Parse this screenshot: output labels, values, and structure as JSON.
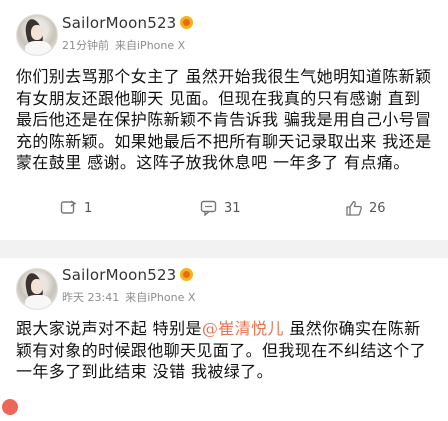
{
  "posts": [
    {
      "username": "SailorMoon523",
      "time": "21分钟前",
      "source": "来自iPhone X",
      "content": "你们别去骂那个女主了 虽然开始我很生气她明知道陈新颖有女朋友还跟他聊天 见面。但现在我真的只有感谢 直到最后他还是在保护陈新颖不肯告诉我 骗我是用自己小号冒充的陈新颖。如果她最后不把所有聊天记录取出来 我还是蒙在鼓里 感谢。这阵子放我休息吧 一年多了 有点痛。",
      "actions": {
        "repost": "1",
        "comment": "31",
        "like": "26"
      }
    },
    {
      "username": "SailorMoon523",
      "time": "昨天 23:41",
      "source": "来自iPhone X",
      "content_before": "跟大家说声对不起 特别是",
      "mention": "@崔清悦儿",
      "content_after": " 虽然你确实在陈新颖有对象的时候跟他聊天见面了。但我现在不纠结这个了 一年多了到此结束 没错 我被绿了。"
    }
  ],
  "icons": {
    "repost": "repost-icon",
    "comment": "comment-icon",
    "like": "like-icon",
    "badge": "vip-badge-icon"
  },
  "colors": {
    "badge": "#f6b21b",
    "mention": "#eb7350",
    "meta": "#8d8d8d",
    "divider": "#f2f2f2"
  }
}
